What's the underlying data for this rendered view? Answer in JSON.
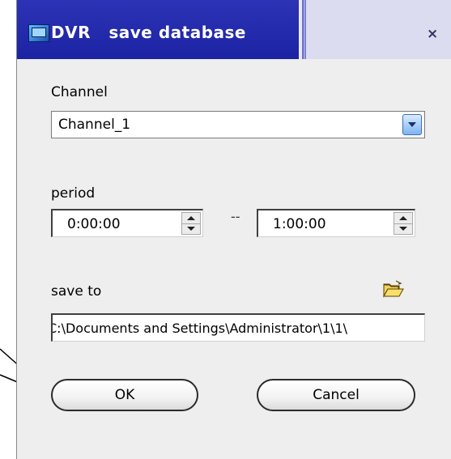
{
  "window": {
    "title": "DVR   save database",
    "close_label": "×"
  },
  "channel": {
    "label": "Channel",
    "selected": "Channel_1"
  },
  "period": {
    "label": "period",
    "start": "0:00:00",
    "separator": "--",
    "end": "1:00:00"
  },
  "save_to": {
    "label": "save to",
    "path": "C:\\Documents and Settings\\Administrator\\1\\1\\"
  },
  "buttons": {
    "ok": "OK",
    "cancel": "Cancel"
  },
  "icons": {
    "app": "dvr-app-icon",
    "browse": "open-folder-icon",
    "combo": "dropdown-arrow-icon"
  },
  "colors": {
    "titlebar": "#2c33b6",
    "titlebar_inactive": "#dcdcf0",
    "dialog_bg": "#eeeeee",
    "combo_button": "#7db4f1",
    "folder": "#e8c33a"
  }
}
